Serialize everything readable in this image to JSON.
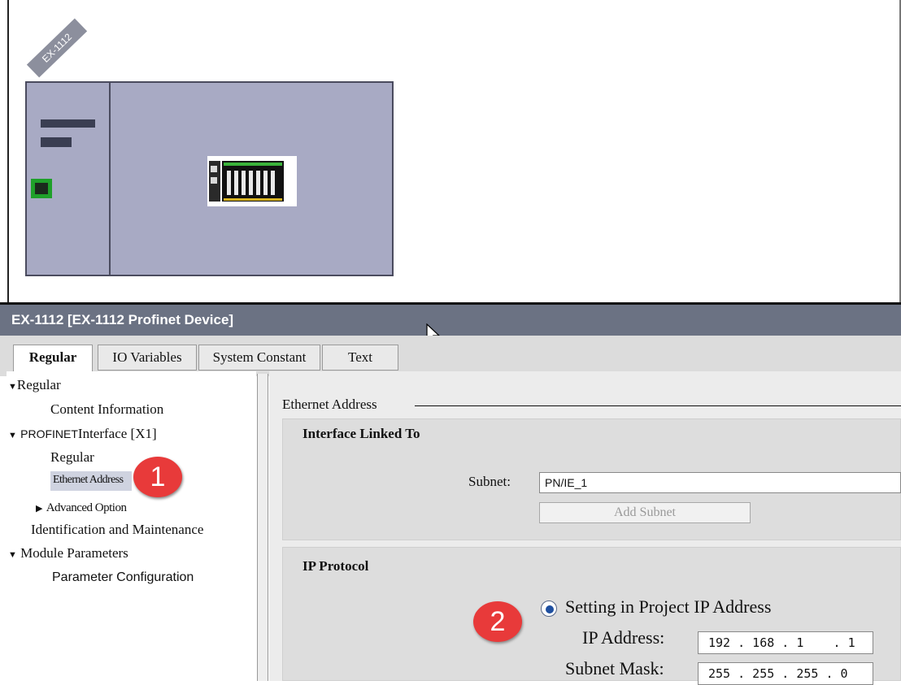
{
  "device_view": {
    "device_tag": "EX-1112"
  },
  "properties": {
    "title": "EX-1112 [EX-1112 Profinet Device]",
    "tabs": [
      {
        "label": "Regular",
        "active": true
      },
      {
        "label": "IO Variables",
        "active": false
      },
      {
        "label": "System Constant",
        "active": false
      },
      {
        "label": "Text",
        "active": false
      }
    ],
    "tree": [
      "Regular",
      "Content Information",
      "PROFINET",
      "Interface [X1]",
      "Regular",
      "Ethernet Address",
      "Advanced Option",
      "Identification and Maintenance",
      "Module Parameters",
      "Parameter Configuration"
    ],
    "badges": [
      "1",
      "2"
    ]
  },
  "ethernet": {
    "header": "Ethernet Address",
    "interface_section": {
      "title": "Interface Linked To",
      "subnet_label": "Subnet:",
      "subnet_value": "PN/IE_1",
      "add_subnet_button": "Add Subnet"
    },
    "ip_section": {
      "title": "IP Protocol",
      "radio_label": "Setting in Project IP Address",
      "ip_label": "IP Address:",
      "ip_value": "192 . 168 . 1    . 1",
      "mask_label": "Subnet Mask:",
      "mask_value": "255 . 255 . 255 . 0"
    }
  },
  "colors": {
    "title_bar": "#6b7283",
    "device_body": "#a8aac4",
    "badge": "#e83a3a",
    "port": "#1fa02a"
  }
}
